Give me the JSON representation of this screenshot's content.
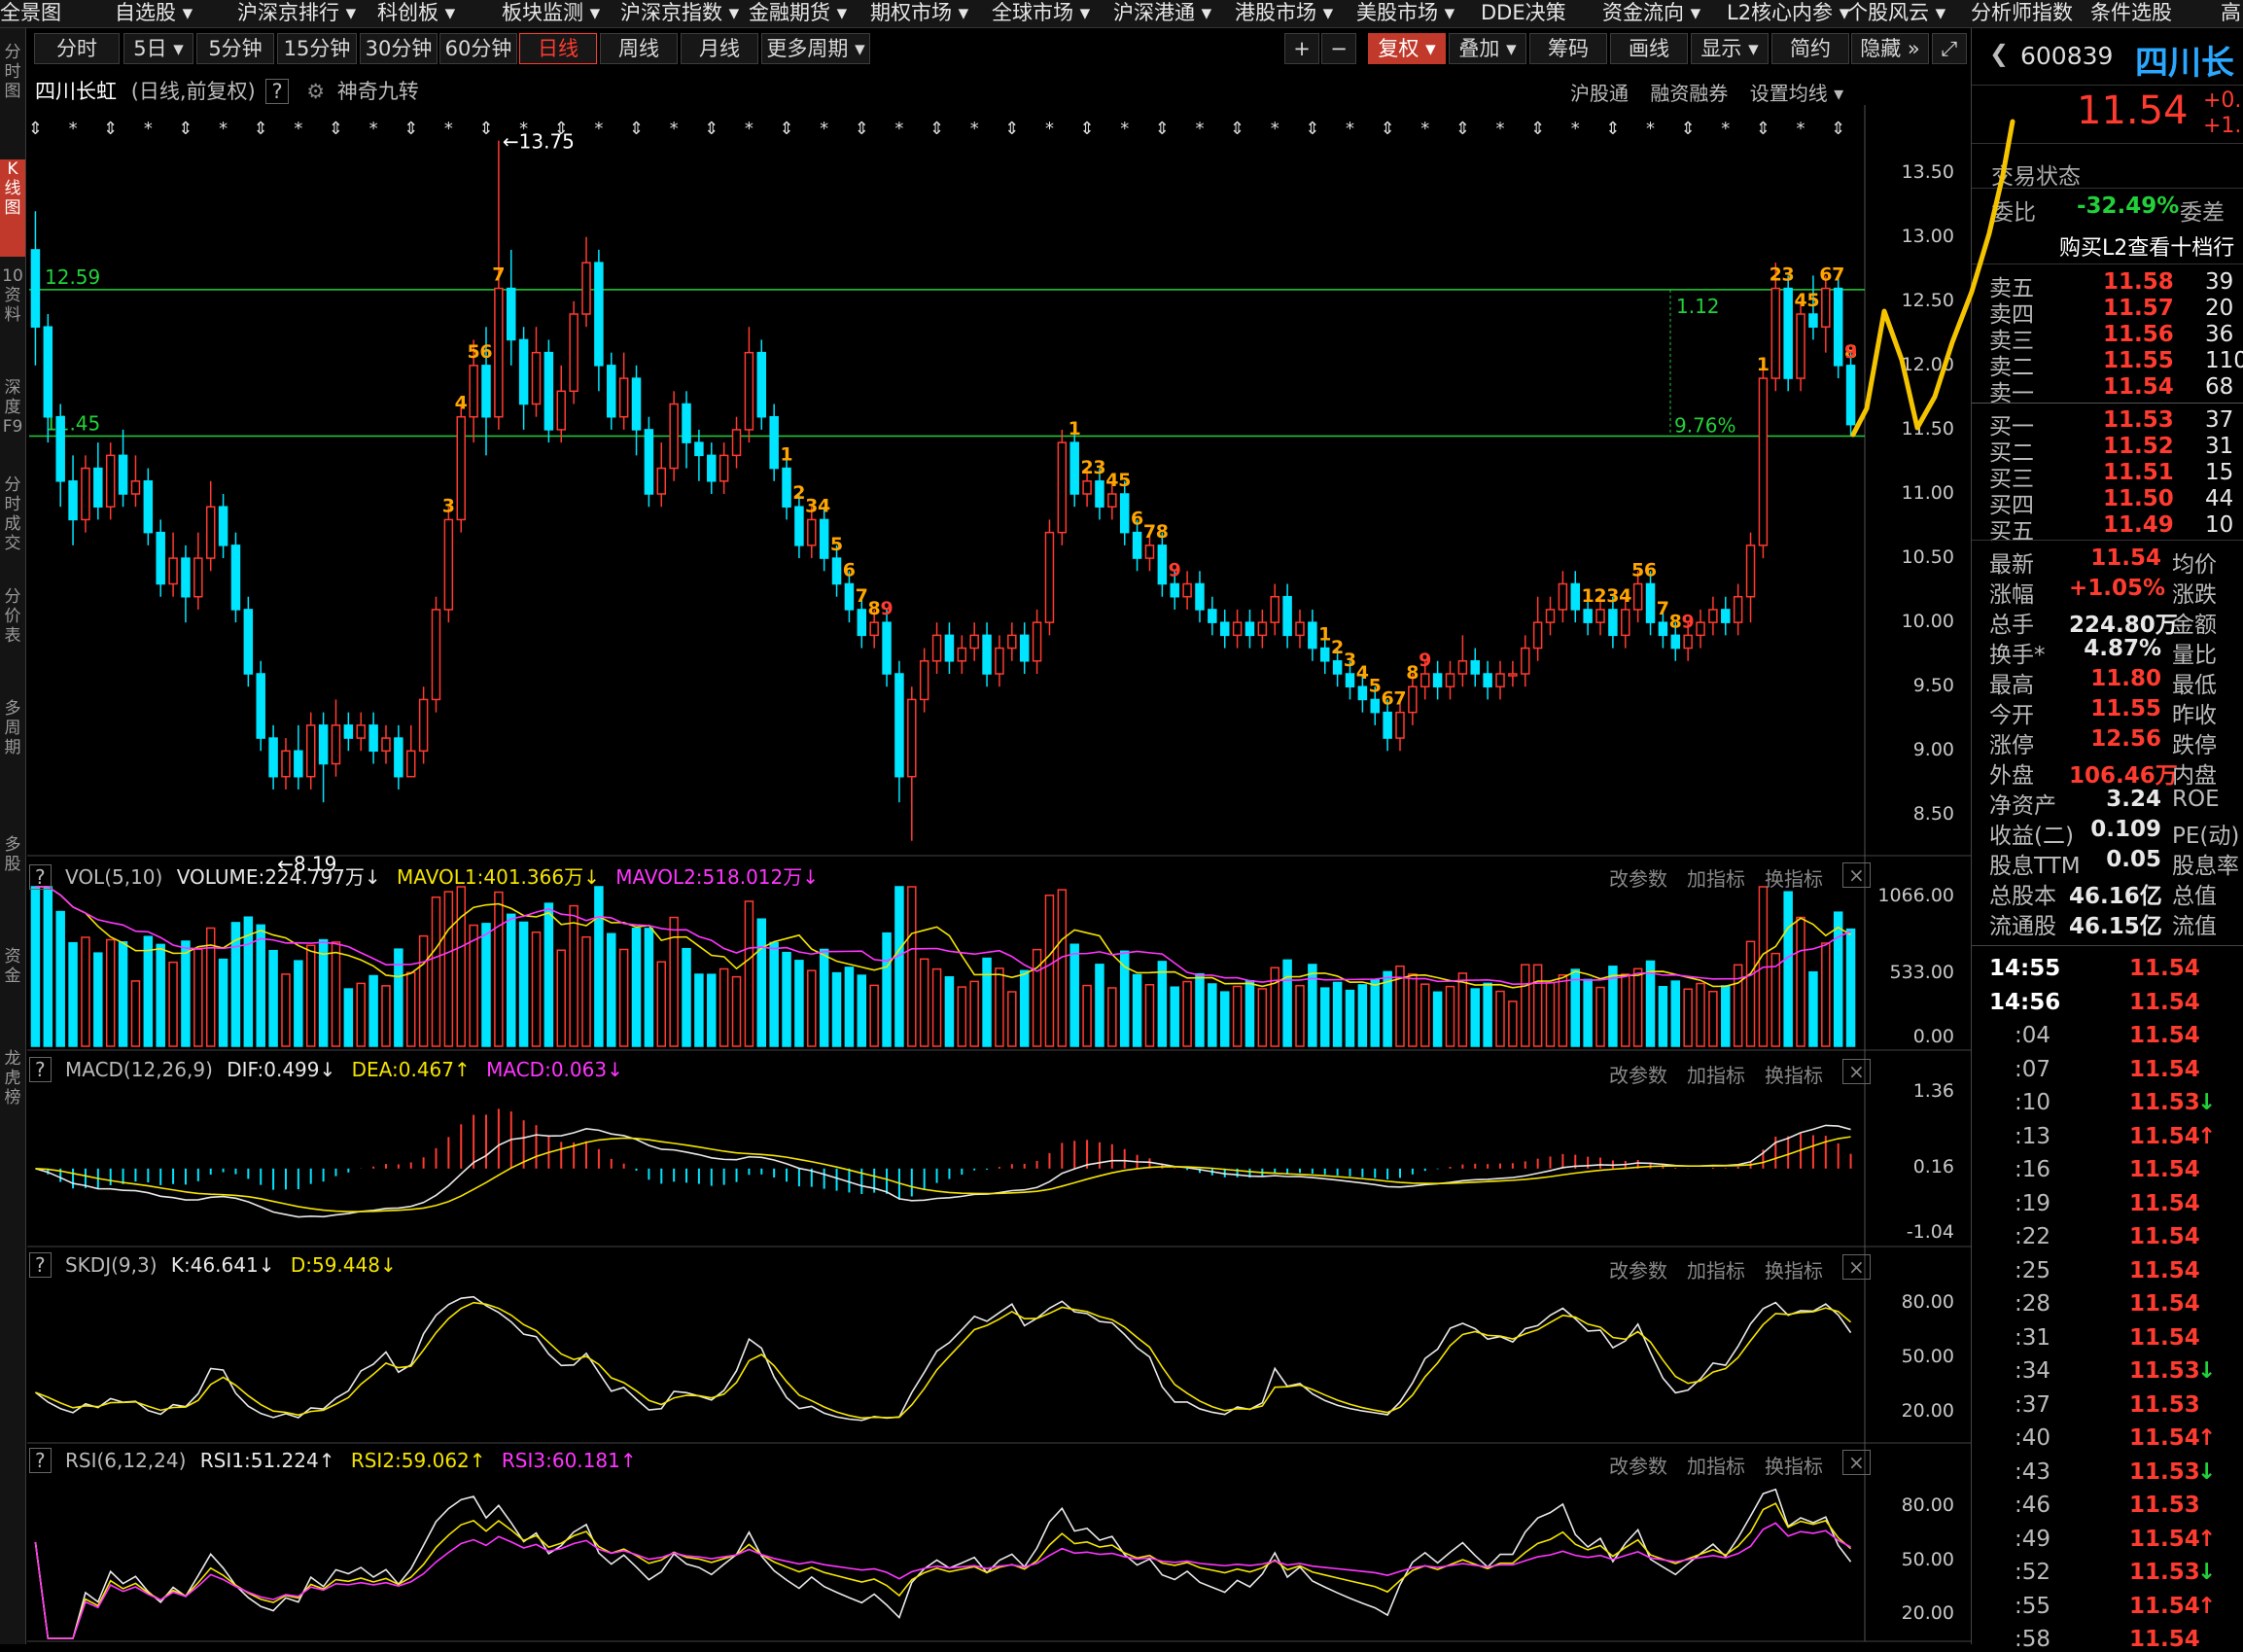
{
  "nav": {
    "items": [
      "全景图",
      "自选股 ▾",
      "沪深京排行 ▾",
      "科创板 ▾",
      "板块监测 ▾",
      "沪深京指数 ▾",
      "金融期货 ▾",
      "期权市场 ▾",
      "全球市场 ▾",
      "沪深港通 ▾",
      "港股市场 ▾",
      "美股市场 ▾",
      "DDE决策",
      "资金流向 ▾",
      "L2核心内参 ▾",
      "个股风云 ▾",
      "分析师指数",
      "条件选股",
      "高"
    ]
  },
  "leftbar": {
    "items": [
      "分时图",
      "K线图",
      "10资料",
      "深度F9",
      "分时成交",
      "分价表",
      "多周期",
      "多股",
      "资金",
      "龙虎榜"
    ]
  },
  "toolbar": {
    "periods": [
      "分时",
      "5日 ▾",
      "5分钟",
      "15分钟",
      "30分钟",
      "60分钟",
      "日线",
      "周线",
      "月线",
      "更多周期 ▾"
    ],
    "active_period": "日线",
    "right_tools": [
      "+",
      "−",
      "复权 ▾",
      "叠加 ▾",
      "筹码",
      "画线",
      "显示 ▾",
      "简约",
      "隐藏 »",
      "⤢"
    ]
  },
  "chart_title": {
    "name": "四川长虹",
    "mode": "(日线,前复权)",
    "help": "?",
    "indicator": "神奇九转",
    "links": [
      "沪股通",
      "融资融券",
      "设置均线 ▾"
    ]
  },
  "chart_data": {
    "type": "candlestick",
    "ylim": [
      8.2,
      13.8
    ],
    "y_ticks": [
      13.5,
      13.0,
      12.5,
      12.0,
      11.5,
      11.0,
      10.5,
      10.0,
      9.5,
      9.0,
      8.5
    ],
    "high_label": "13.75",
    "low_label": "8.19",
    "hlines": [
      {
        "value": 12.59,
        "label": "12.59",
        "color": "#22d13a"
      },
      {
        "value": 11.45,
        "label": "11.45",
        "color": "#22d13a"
      }
    ],
    "range_annotation": {
      "diff": "1.12",
      "pct": "9.76%"
    },
    "candles": [
      [
        12.9,
        12.3,
        13.2,
        12.0
      ],
      [
        12.3,
        11.6,
        12.4,
        11.4
      ],
      [
        11.6,
        11.1,
        11.7,
        10.9
      ],
      [
        11.1,
        10.8,
        11.3,
        10.6
      ],
      [
        10.8,
        11.2,
        11.3,
        10.7
      ],
      [
        11.2,
        10.9,
        11.4,
        10.8
      ],
      [
        10.9,
        11.3,
        11.4,
        10.8
      ],
      [
        11.3,
        11.0,
        11.5,
        10.9
      ],
      [
        11.0,
        11.1,
        11.3,
        10.9
      ],
      [
        11.1,
        10.7,
        11.2,
        10.6
      ],
      [
        10.7,
        10.3,
        10.8,
        10.2
      ],
      [
        10.3,
        10.5,
        10.7,
        10.2
      ],
      [
        10.5,
        10.2,
        10.6,
        10.0
      ],
      [
        10.2,
        10.5,
        10.7,
        10.1
      ],
      [
        10.5,
        10.9,
        11.1,
        10.4
      ],
      [
        10.9,
        10.6,
        11.0,
        10.5
      ],
      [
        10.6,
        10.1,
        10.7,
        10.0
      ],
      [
        10.1,
        9.6,
        10.2,
        9.5
      ],
      [
        9.6,
        9.1,
        9.7,
        9.0
      ],
      [
        9.1,
        8.8,
        9.2,
        8.7
      ],
      [
        8.8,
        9.0,
        9.1,
        8.7
      ],
      [
        9.0,
        8.8,
        9.2,
        8.7
      ],
      [
        8.8,
        9.2,
        9.3,
        8.7
      ],
      [
        9.2,
        8.9,
        9.3,
        8.6
      ],
      [
        8.9,
        9.2,
        9.4,
        8.8
      ],
      [
        9.2,
        9.1,
        9.3,
        9.0
      ],
      [
        9.1,
        9.2,
        9.3,
        9.0
      ],
      [
        9.2,
        9.0,
        9.3,
        8.9
      ],
      [
        9.0,
        9.1,
        9.2,
        8.9
      ],
      [
        9.1,
        8.8,
        9.2,
        8.7
      ],
      [
        8.8,
        9.0,
        9.2,
        8.8
      ],
      [
        9.0,
        9.4,
        9.5,
        8.9
      ],
      [
        9.4,
        10.1,
        10.2,
        9.3
      ],
      [
        10.1,
        10.8,
        10.9,
        10.0
      ],
      [
        10.8,
        11.6,
        11.7,
        10.7
      ],
      [
        11.6,
        12.0,
        12.2,
        11.4
      ],
      [
        12.0,
        11.6,
        12.3,
        11.3
      ],
      [
        11.6,
        12.6,
        13.75,
        11.5
      ],
      [
        12.6,
        12.2,
        12.9,
        12.0
      ],
      [
        12.2,
        11.7,
        12.3,
        11.5
      ],
      [
        11.7,
        12.1,
        12.3,
        11.6
      ],
      [
        12.1,
        11.5,
        12.2,
        11.4
      ],
      [
        11.5,
        11.8,
        12.0,
        11.4
      ],
      [
        11.8,
        12.4,
        12.5,
        11.7
      ],
      [
        12.4,
        12.8,
        13.0,
        12.3
      ],
      [
        12.8,
        12.0,
        12.9,
        11.8
      ],
      [
        12.0,
        11.6,
        12.1,
        11.5
      ],
      [
        11.6,
        11.9,
        12.1,
        11.5
      ],
      [
        11.9,
        11.5,
        12.0,
        11.3
      ],
      [
        11.5,
        11.0,
        11.6,
        10.9
      ],
      [
        11.0,
        11.2,
        11.4,
        10.9
      ],
      [
        11.2,
        11.7,
        11.8,
        11.1
      ],
      [
        11.7,
        11.4,
        11.8,
        11.2
      ],
      [
        11.4,
        11.3,
        11.5,
        11.1
      ],
      [
        11.3,
        11.1,
        11.4,
        11.0
      ],
      [
        11.1,
        11.3,
        11.4,
        11.0
      ],
      [
        11.3,
        11.5,
        11.6,
        11.2
      ],
      [
        11.5,
        12.1,
        12.3,
        11.4
      ],
      [
        12.1,
        11.6,
        12.2,
        11.5
      ],
      [
        11.6,
        11.2,
        11.7,
        11.1
      ],
      [
        11.2,
        10.9,
        11.3,
        10.8
      ],
      [
        10.9,
        10.6,
        11.0,
        10.5
      ],
      [
        10.6,
        10.8,
        10.9,
        10.5
      ],
      [
        10.8,
        10.5,
        10.9,
        10.4
      ],
      [
        10.5,
        10.3,
        10.6,
        10.2
      ],
      [
        10.3,
        10.1,
        10.4,
        10.0
      ],
      [
        10.1,
        9.9,
        10.2,
        9.8
      ],
      [
        9.9,
        10.0,
        10.1,
        9.8
      ],
      [
        10.0,
        9.6,
        10.1,
        9.5
      ],
      [
        9.6,
        8.8,
        9.7,
        8.6
      ],
      [
        8.8,
        9.4,
        9.5,
        8.3
      ],
      [
        9.4,
        9.7,
        9.8,
        9.3
      ],
      [
        9.7,
        9.9,
        10.0,
        9.6
      ],
      [
        9.9,
        9.7,
        10.0,
        9.6
      ],
      [
        9.7,
        9.8,
        9.9,
        9.6
      ],
      [
        9.8,
        9.9,
        10.0,
        9.7
      ],
      [
        9.9,
        9.6,
        10.0,
        9.5
      ],
      [
        9.6,
        9.8,
        9.9,
        9.5
      ],
      [
        9.8,
        9.9,
        10.0,
        9.7
      ],
      [
        9.9,
        9.7,
        10.0,
        9.6
      ],
      [
        9.7,
        10.0,
        10.1,
        9.6
      ],
      [
        10.0,
        10.7,
        10.8,
        9.9
      ],
      [
        10.7,
        11.4,
        11.5,
        10.6
      ],
      [
        11.4,
        11.0,
        11.5,
        10.9
      ],
      [
        11.0,
        11.1,
        11.2,
        10.9
      ],
      [
        11.1,
        10.9,
        11.2,
        10.8
      ],
      [
        10.9,
        11.0,
        11.1,
        10.8
      ],
      [
        11.0,
        10.7,
        11.1,
        10.6
      ],
      [
        10.7,
        10.5,
        10.8,
        10.4
      ],
      [
        10.5,
        10.6,
        10.7,
        10.4
      ],
      [
        10.6,
        10.3,
        10.7,
        10.2
      ],
      [
        10.3,
        10.2,
        10.4,
        10.1
      ],
      [
        10.2,
        10.3,
        10.4,
        10.1
      ],
      [
        10.3,
        10.1,
        10.4,
        10.0
      ],
      [
        10.1,
        10.0,
        10.2,
        9.9
      ],
      [
        10.0,
        9.9,
        10.1,
        9.8
      ],
      [
        9.9,
        10.0,
        10.1,
        9.8
      ],
      [
        10.0,
        9.9,
        10.1,
        9.8
      ],
      [
        9.9,
        10.0,
        10.1,
        9.8
      ],
      [
        10.0,
        10.2,
        10.3,
        9.9
      ],
      [
        10.2,
        9.9,
        10.3,
        9.8
      ],
      [
        9.9,
        10.0,
        10.1,
        9.8
      ],
      [
        10.0,
        9.8,
        10.1,
        9.7
      ],
      [
        9.8,
        9.7,
        9.9,
        9.6
      ],
      [
        9.7,
        9.6,
        9.8,
        9.5
      ],
      [
        9.6,
        9.5,
        9.7,
        9.4
      ],
      [
        9.5,
        9.4,
        9.6,
        9.3
      ],
      [
        9.4,
        9.3,
        9.5,
        9.2
      ],
      [
        9.3,
        9.1,
        9.4,
        9.0
      ],
      [
        9.1,
        9.3,
        9.4,
        9.0
      ],
      [
        9.3,
        9.5,
        9.6,
        9.2
      ],
      [
        9.5,
        9.6,
        9.7,
        9.4
      ],
      [
        9.6,
        9.5,
        9.7,
        9.4
      ],
      [
        9.5,
        9.6,
        9.7,
        9.4
      ],
      [
        9.6,
        9.7,
        9.9,
        9.5
      ],
      [
        9.7,
        9.6,
        9.8,
        9.5
      ],
      [
        9.6,
        9.5,
        9.7,
        9.4
      ],
      [
        9.5,
        9.6,
        9.7,
        9.4
      ],
      [
        9.6,
        9.6,
        9.7,
        9.5
      ],
      [
        9.6,
        9.8,
        9.9,
        9.5
      ],
      [
        9.8,
        10.0,
        10.2,
        9.7
      ],
      [
        10.0,
        10.1,
        10.2,
        9.9
      ],
      [
        10.1,
        10.3,
        10.4,
        10.0
      ],
      [
        10.3,
        10.1,
        10.4,
        10.0
      ],
      [
        10.1,
        10.0,
        10.2,
        9.9
      ],
      [
        10.0,
        10.1,
        10.2,
        9.9
      ],
      [
        10.1,
        9.9,
        10.2,
        9.8
      ],
      [
        9.9,
        10.1,
        10.2,
        9.8
      ],
      [
        10.1,
        10.3,
        10.4,
        10.0
      ],
      [
        10.3,
        10.0,
        10.4,
        9.9
      ],
      [
        10.0,
        9.9,
        10.1,
        9.8
      ],
      [
        9.9,
        9.8,
        10.0,
        9.7
      ],
      [
        9.8,
        9.9,
        10.0,
        9.7
      ],
      [
        9.9,
        10.0,
        10.1,
        9.8
      ],
      [
        10.0,
        10.1,
        10.2,
        9.9
      ],
      [
        10.1,
        10.0,
        10.2,
        9.9
      ],
      [
        10.0,
        10.2,
        10.3,
        9.9
      ],
      [
        10.2,
        10.6,
        10.7,
        10.0
      ],
      [
        10.6,
        11.9,
        12.0,
        10.5
      ],
      [
        11.9,
        12.6,
        12.8,
        11.8
      ],
      [
        12.6,
        11.9,
        12.7,
        11.8
      ],
      [
        11.9,
        12.4,
        12.5,
        11.8
      ],
      [
        12.4,
        12.3,
        12.7,
        12.2
      ],
      [
        12.3,
        12.6,
        12.7,
        12.1
      ],
      [
        12.6,
        12.0,
        12.7,
        11.9
      ],
      [
        12.0,
        11.54,
        12.1,
        11.45
      ]
    ]
  },
  "price_axis": [
    "13.50",
    "13.00",
    "12.50",
    "12.00",
    "11.50",
    "11.00",
    "10.50",
    "10.00",
    "9.50",
    "9.00",
    "8.50"
  ],
  "vol": {
    "title": "VOL(5,10)",
    "volume": "VOLUME:224.797万",
    "mavol1": "MAVOL1:401.366万",
    "mavol2": "MAVOL2:518.012万",
    "axis": [
      "1066.00",
      "533.00",
      "0.00"
    ]
  },
  "macd": {
    "title": "MACD(12,26,9)",
    "dif": "DIF:0.499",
    "dea": "DEA:0.467",
    "macd": "MACD:0.063",
    "axis": [
      "1.36",
      "0.16",
      "-1.04"
    ]
  },
  "skdj": {
    "title": "SKDJ(9,3)",
    "k": "K:46.641",
    "d": "D:59.448",
    "axis": [
      "80.00",
      "50.00",
      "20.00"
    ]
  },
  "rsi": {
    "title": "RSI(6,12,24)",
    "rsi1": "RSI1:51.224",
    "rsi2": "RSI2:59.062",
    "rsi3": "RSI3:60.181",
    "axis": [
      "80.00",
      "50.00",
      "20.00"
    ]
  },
  "panel_ctl": {
    "params": "改参数",
    "add": "加指标",
    "swap": "换指标",
    "close": "×",
    "help": "?"
  },
  "quote": {
    "code": "600839",
    "name": "四川长",
    "price": "11.54",
    "change": "+0.",
    "change_pct": "+1.",
    "status": "交易状态",
    "weibi_label": "委比",
    "weibi": "-32.49%",
    "weicha_label": "委差",
    "l2_banner": "购买L2查看十档行",
    "asks": [
      {
        "label": "卖五",
        "price": "11.58",
        "vol": "39"
      },
      {
        "label": "卖四",
        "price": "11.57",
        "vol": "20"
      },
      {
        "label": "卖三",
        "price": "11.56",
        "vol": "36"
      },
      {
        "label": "卖二",
        "price": "11.55",
        "vol": "110"
      },
      {
        "label": "卖一",
        "price": "11.54",
        "vol": "68"
      }
    ],
    "bids": [
      {
        "label": "买一",
        "price": "11.53",
        "vol": "37"
      },
      {
        "label": "买二",
        "price": "11.52",
        "vol": "31"
      },
      {
        "label": "买三",
        "price": "11.51",
        "vol": "15"
      },
      {
        "label": "买四",
        "price": "11.50",
        "vol": "44"
      },
      {
        "label": "买五",
        "price": "11.49",
        "vol": "10"
      }
    ],
    "stats": [
      {
        "l": "最新",
        "v": "11.54",
        "r": "均价",
        "c": "red"
      },
      {
        "l": "涨幅",
        "v": "+1.05%",
        "r": "涨跌",
        "c": "red"
      },
      {
        "l": "总手",
        "v": "224.80万",
        "r": "金额",
        "c": "wht"
      },
      {
        "l": "换手*",
        "v": "4.87%",
        "r": "量比",
        "c": "wht"
      },
      {
        "l": "最高",
        "v": "11.80",
        "r": "最低",
        "c": "red"
      },
      {
        "l": "今开",
        "v": "11.55",
        "r": "昨收",
        "c": "red"
      },
      {
        "l": "涨停",
        "v": "12.56",
        "r": "跌停",
        "c": "red"
      },
      {
        "l": "外盘",
        "v": "106.46万",
        "r": "内盘",
        "c": "red"
      },
      {
        "l": "净资产",
        "v": "3.24",
        "r": "ROE",
        "c": "wht"
      },
      {
        "l": "收益(二)",
        "v": "0.109",
        "r": "PE(动)",
        "c": "wht"
      },
      {
        "l": "股息TTM",
        "v": "0.05",
        "r": "股息率",
        "c": "wht"
      },
      {
        "l": "总股本",
        "v": "46.16亿",
        "r": "总值",
        "c": "wht"
      },
      {
        "l": "流通股",
        "v": "46.15亿",
        "r": "流值",
        "c": "wht"
      }
    ],
    "ticks": [
      {
        "t": "14:55",
        "p": "11.54",
        "a": ""
      },
      {
        "t": "14:56",
        "p": "11.54",
        "a": ""
      },
      {
        "t": ":04",
        "p": "11.54",
        "a": ""
      },
      {
        "t": ":07",
        "p": "11.54",
        "a": ""
      },
      {
        "t": ":10",
        "p": "11.53",
        "a": "↓"
      },
      {
        "t": ":13",
        "p": "11.54",
        "a": "↑"
      },
      {
        "t": ":16",
        "p": "11.54",
        "a": ""
      },
      {
        "t": ":19",
        "p": "11.54",
        "a": ""
      },
      {
        "t": ":22",
        "p": "11.54",
        "a": ""
      },
      {
        "t": ":25",
        "p": "11.54",
        "a": ""
      },
      {
        "t": ":28",
        "p": "11.54",
        "a": ""
      },
      {
        "t": ":31",
        "p": "11.54",
        "a": ""
      },
      {
        "t": ":34",
        "p": "11.53",
        "a": "↓"
      },
      {
        "t": ":37",
        "p": "11.53",
        "a": ""
      },
      {
        "t": ":40",
        "p": "11.54",
        "a": "↑"
      },
      {
        "t": ":43",
        "p": "11.53",
        "a": "↓"
      },
      {
        "t": ":46",
        "p": "11.53",
        "a": ""
      },
      {
        "t": ":49",
        "p": "11.54",
        "a": "↑"
      },
      {
        "t": ":52",
        "p": "11.53",
        "a": "↓"
      },
      {
        "t": ":55",
        "p": "11.54",
        "a": "↑"
      },
      {
        "t": ":58",
        "p": "11.54",
        "a": ""
      }
    ]
  },
  "colors": {
    "up": "#ff3b30",
    "down": "#00e5ff",
    "green": "#22d13a",
    "yellow": "#f5e400",
    "magenta": "#ff36ff",
    "orange": "#ffa500"
  }
}
